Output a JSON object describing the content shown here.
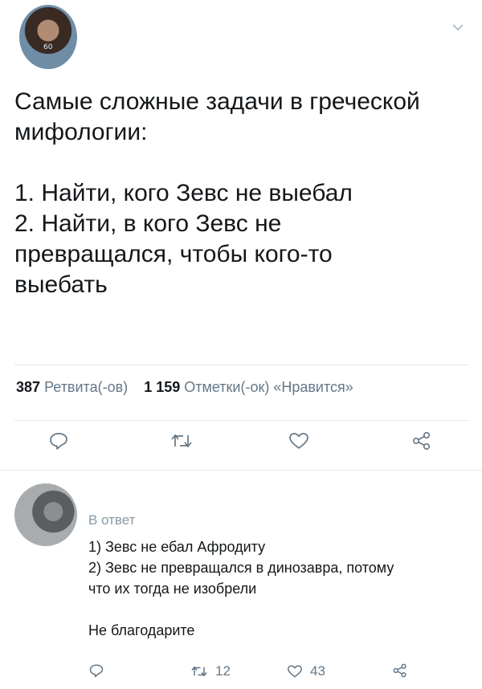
{
  "tweet": {
    "text": "Самые сложные задачи в греческой\nмифологии:\n\n1. Найти, кого Зевс не выебал\n2. Найти, в кого Зевс не\nпревращался, чтобы кого-то\nвыебать",
    "retweets_count": "387",
    "retweets_label": "Ретвита(-ов)",
    "likes_count": "1 159",
    "likes_label": "Отметки(-ок) «Нравится»",
    "avatar_badge": "60"
  },
  "icons": {
    "more": "chevron-down-icon",
    "reply": "reply-icon",
    "retweet": "retweet-icon",
    "like": "heart-icon",
    "share": "share-icon"
  },
  "reply": {
    "prefix": "В ответ",
    "text": "1) Зевс не ебал Афродиту\n2) Зевс не превращался в динозавра, потому\nчто их тогда не изобрели\n\nНе благодарите",
    "retweet_count": "12",
    "like_count": "43"
  },
  "colors": {
    "text": "#14171a",
    "secondary": "#657786",
    "divider": "#e1e8ed"
  }
}
